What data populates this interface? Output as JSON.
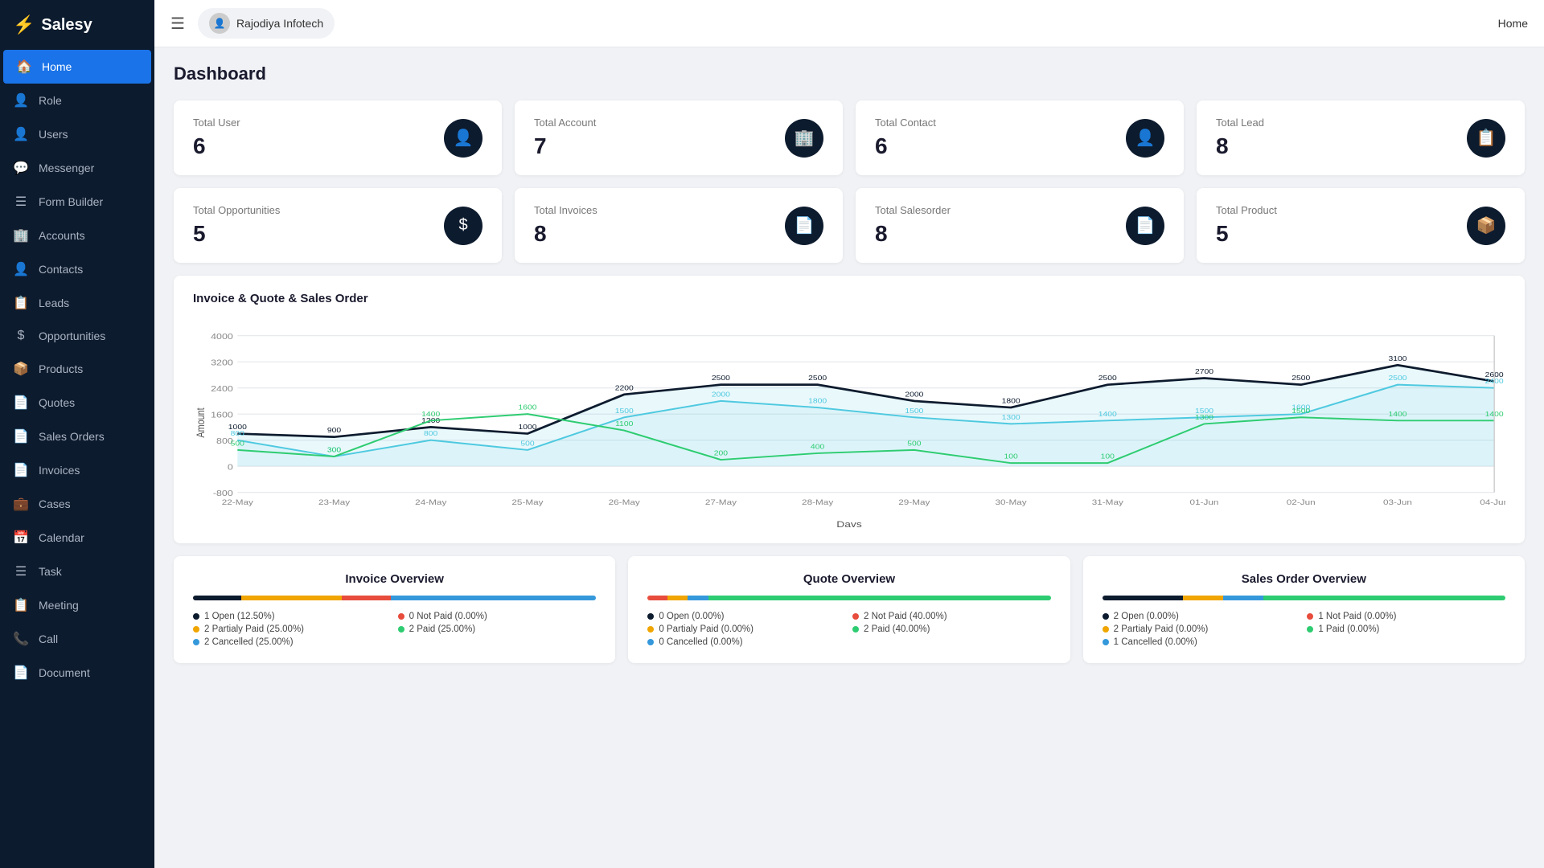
{
  "app": {
    "name": "Salesy",
    "current_page": "Home"
  },
  "header": {
    "user": "Rajodiya Infotech",
    "home_label": "Home",
    "hamburger_label": "☰"
  },
  "sidebar": {
    "items": [
      {
        "id": "home",
        "label": "Home",
        "icon": "🏠",
        "active": true
      },
      {
        "id": "role",
        "label": "Role",
        "icon": "👤"
      },
      {
        "id": "users",
        "label": "Users",
        "icon": "👤"
      },
      {
        "id": "messenger",
        "label": "Messenger",
        "icon": "💬"
      },
      {
        "id": "form-builder",
        "label": "Form Builder",
        "icon": "☰"
      },
      {
        "id": "accounts",
        "label": "Accounts",
        "icon": "🏢"
      },
      {
        "id": "contacts",
        "label": "Contacts",
        "icon": "👤"
      },
      {
        "id": "leads",
        "label": "Leads",
        "icon": "📋"
      },
      {
        "id": "opportunities",
        "label": "Opportunities",
        "icon": "$"
      },
      {
        "id": "products",
        "label": "Products",
        "icon": "📦"
      },
      {
        "id": "quotes",
        "label": "Quotes",
        "icon": "📄"
      },
      {
        "id": "sales-orders",
        "label": "Sales Orders",
        "icon": "📄"
      },
      {
        "id": "invoices",
        "label": "Invoices",
        "icon": "📄"
      },
      {
        "id": "cases",
        "label": "Cases",
        "icon": "💼"
      },
      {
        "id": "calendar",
        "label": "Calendar",
        "icon": "📅"
      },
      {
        "id": "task",
        "label": "Task",
        "icon": "☰"
      },
      {
        "id": "meeting",
        "label": "Meeting",
        "icon": "📋"
      },
      {
        "id": "call",
        "label": "Call",
        "icon": "📞"
      },
      {
        "id": "document",
        "label": "Document",
        "icon": "📄"
      }
    ]
  },
  "dashboard": {
    "title": "Dashboard",
    "stats": [
      {
        "label": "Total User",
        "value": "6",
        "icon": "👤"
      },
      {
        "label": "Total Account",
        "value": "7",
        "icon": "🏢"
      },
      {
        "label": "Total Contact",
        "value": "6",
        "icon": "👤"
      },
      {
        "label": "Total Lead",
        "value": "8",
        "icon": "📋"
      },
      {
        "label": "Total Opportunities",
        "value": "5",
        "icon": "$"
      },
      {
        "label": "Total Invoices",
        "value": "8",
        "icon": "📄"
      },
      {
        "label": "Total Salesorder",
        "value": "8",
        "icon": "📄"
      },
      {
        "label": "Total Product",
        "value": "5",
        "icon": "📦"
      }
    ],
    "chart": {
      "title": "Invoice & Quote & Sales Order",
      "x_label": "Days",
      "y_label": "Amount",
      "x_axis": [
        "22-May",
        "23-May",
        "24-May",
        "25-May",
        "26-May",
        "27-May",
        "28-May",
        "29-May",
        "30-May",
        "31-May",
        "01-Jun",
        "02-Jun",
        "03-Jun",
        "04-Jun"
      ],
      "y_ticks": [
        "-800",
        "0",
        "800",
        "1600",
        "2400",
        "3200",
        "4000"
      ],
      "series": [
        {
          "name": "Invoice",
          "color": "#0d1b2e",
          "values": [
            1000,
            900,
            1200,
            1000,
            2200,
            2500,
            2500,
            2000,
            1800,
            2500,
            2700,
            2500,
            3100,
            2600
          ]
        },
        {
          "name": "Quote",
          "color": "#4ec9e0",
          "values": [
            800,
            300,
            800,
            500,
            1500,
            2000,
            1800,
            1500,
            1300,
            1400,
            1500,
            1600,
            2500,
            2400
          ]
        },
        {
          "name": "Sales Order",
          "color": "#2ecc71",
          "values": [
            500,
            300,
            1400,
            1600,
            1100,
            200,
            400,
            500,
            100,
            100,
            1300,
            1500,
            1400,
            1400
          ]
        }
      ],
      "annotations": {
        "invoice": [
          1000,
          900,
          1200,
          1000,
          2200,
          2500,
          2500,
          2000,
          1800,
          2500,
          2700,
          2500,
          3100,
          2600
        ],
        "quote": [
          800,
          300,
          800,
          500,
          1500,
          2000,
          1800,
          1500,
          1300,
          1400,
          1500,
          1600,
          2500,
          2400
        ],
        "salesorder": [
          500,
          300,
          1400,
          1600,
          1100,
          200,
          400,
          500,
          100,
          100,
          1300,
          1500,
          1400,
          1400
        ]
      }
    },
    "overview": [
      {
        "title": "Invoice Overview",
        "progress": [
          {
            "pct": 12,
            "color": "#0d1b2e"
          },
          {
            "pct": 25,
            "color": "#f0a500"
          },
          {
            "pct": 12,
            "color": "#e74c3c"
          },
          {
            "pct": 51,
            "color": "#3498db"
          }
        ],
        "legend": [
          {
            "label": "1 Open (12.50%)",
            "color": "#0d1b2e"
          },
          {
            "label": "0 Not Paid (0.00%)",
            "color": "#e74c3c"
          },
          {
            "label": "2 Partialy Paid (25.00%)",
            "color": "#f0a500"
          },
          {
            "label": "2 Paid (25.00%)",
            "color": "#2ecc71"
          },
          {
            "label": "2 Cancelled (25.00%)",
            "color": "#3498db"
          }
        ]
      },
      {
        "title": "Quote Overview",
        "progress": [
          {
            "pct": 5,
            "color": "#e74c3c"
          },
          {
            "pct": 5,
            "color": "#f0a500"
          },
          {
            "pct": 5,
            "color": "#3498db"
          },
          {
            "pct": 85,
            "color": "#2ecc71"
          }
        ],
        "legend": [
          {
            "label": "0 Open (0.00%)",
            "color": "#0d1b2e"
          },
          {
            "label": "2 Not Paid (40.00%)",
            "color": "#e74c3c"
          },
          {
            "label": "0 Partialy Paid (0.00%)",
            "color": "#f0a500"
          },
          {
            "label": "2 Paid (40.00%)",
            "color": "#2ecc71"
          },
          {
            "label": "0 Cancelled (0.00%)",
            "color": "#3498db"
          }
        ]
      },
      {
        "title": "Sales Order Overview",
        "progress": [
          {
            "pct": 20,
            "color": "#0d1b2e"
          },
          {
            "pct": 10,
            "color": "#f0a500"
          },
          {
            "pct": 10,
            "color": "#3498db"
          },
          {
            "pct": 60,
            "color": "#2ecc71"
          }
        ],
        "legend": [
          {
            "label": "2 Open (0.00%)",
            "color": "#0d1b2e"
          },
          {
            "label": "1 Not Paid (0.00%)",
            "color": "#e74c3c"
          },
          {
            "label": "2 Partialy Paid (0.00%)",
            "color": "#f0a500"
          },
          {
            "label": "1 Paid (0.00%)",
            "color": "#2ecc71"
          },
          {
            "label": "1 Cancelled (0.00%)",
            "color": "#3498db"
          }
        ]
      }
    ]
  }
}
